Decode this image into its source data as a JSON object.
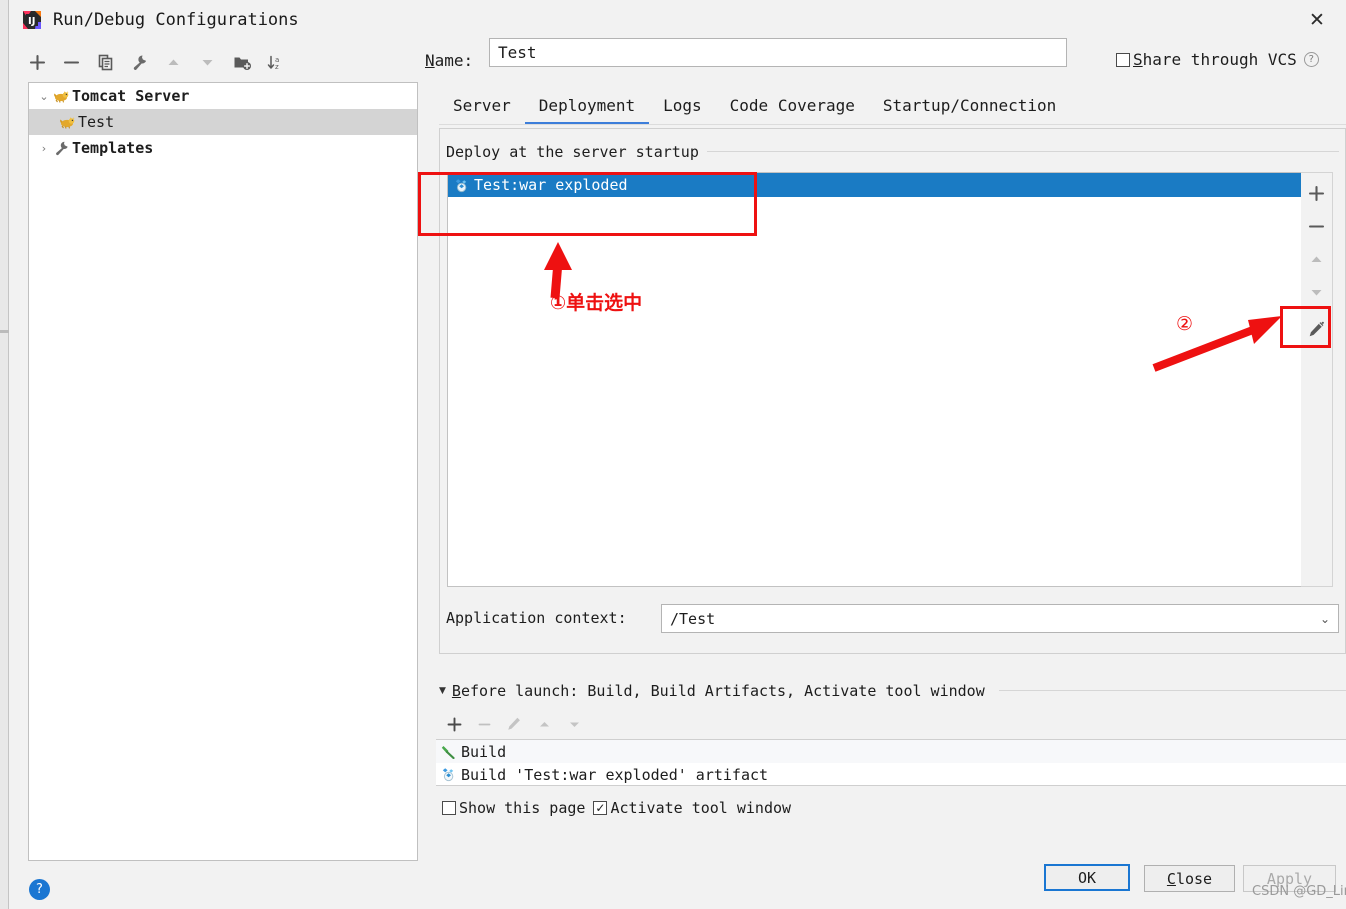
{
  "window": {
    "title": "Run/Debug Configurations",
    "app_icon": "intellij-idea-icon",
    "close_label": "✕"
  },
  "left_panel": {
    "toolbar": [
      {
        "name": "add-configuration-button",
        "icon": "plus-icon",
        "label": "+",
        "enabled": true
      },
      {
        "name": "remove-configuration-button",
        "icon": "minus-icon",
        "label": "−",
        "enabled": true
      },
      {
        "name": "copy-configuration-button",
        "icon": "copy-icon",
        "label": "copy",
        "enabled": true
      },
      {
        "name": "edit-templates-button",
        "icon": "wrench-icon",
        "label": "wrench",
        "enabled": true
      },
      {
        "name": "move-up-button",
        "icon": "arrow-up-icon",
        "label": "▲",
        "enabled": false
      },
      {
        "name": "move-down-button",
        "icon": "arrow-down-icon",
        "label": "▼",
        "enabled": false
      },
      {
        "name": "new-folder-button",
        "icon": "folder-add-icon",
        "label": "folder",
        "enabled": true
      },
      {
        "name": "sort-configurations-button",
        "icon": "sort-alpha-icon",
        "label": "sort",
        "enabled": true
      }
    ],
    "tree": [
      {
        "label": "Tomcat Server",
        "icon": "tomcat-icon",
        "twisty": "⌄",
        "indent": 0,
        "selected": false,
        "bold": true
      },
      {
        "label": "Test",
        "icon": "tomcat-icon",
        "twisty": "",
        "indent": 1,
        "selected": true,
        "bold": false
      },
      {
        "label": "Templates",
        "icon": "wrench-icon",
        "twisty": "›",
        "indent": 0,
        "selected": false,
        "bold": true
      }
    ],
    "help_button": "?"
  },
  "name_row": {
    "label_prefix": "N",
    "label_rest": "ame:",
    "value": "Test",
    "placeholder": "",
    "share_prefix": "S",
    "share_rest": "hare through VCS",
    "share_checked": false,
    "help_icon": "?"
  },
  "tabs": [
    {
      "label": "Server",
      "active": false
    },
    {
      "label": "Deployment",
      "active": true
    },
    {
      "label": "Logs",
      "active": false
    },
    {
      "label": "Code Coverage",
      "active": false
    },
    {
      "label": "Startup/Connection",
      "active": false
    }
  ],
  "deployment": {
    "group_label": "Deploy at the server startup",
    "items": [
      {
        "label": "Test:war exploded",
        "icon": "artifact-icon",
        "selected": true
      }
    ],
    "side_toolbar": [
      {
        "name": "add-artifact-button",
        "icon": "plus-icon",
        "label": "+",
        "enabled": true
      },
      {
        "name": "remove-artifact-button",
        "icon": "minus-icon",
        "label": "−",
        "enabled": true
      },
      {
        "name": "move-artifact-up-button",
        "icon": "arrow-up-icon",
        "label": "▲",
        "enabled": false
      },
      {
        "name": "move-artifact-down-button",
        "icon": "arrow-down-icon",
        "label": "▼",
        "enabled": false
      },
      {
        "name": "edit-artifact-button",
        "icon": "pencil-icon",
        "label": "edit",
        "enabled": true
      }
    ],
    "app_context_label": "Application context:",
    "app_context_value": "/Test",
    "app_context_arrow": "⌄"
  },
  "before_launch": {
    "triangle": "▼",
    "title_prefix": "B",
    "title_rest": "efore launch: Build, Build Artifacts, Activate tool window",
    "toolbar": [
      {
        "name": "add-before-launch-task-button",
        "icon": "plus-icon",
        "label": "+",
        "enabled": true
      },
      {
        "name": "remove-before-launch-task-button",
        "icon": "minus-icon",
        "label": "−",
        "enabled": false
      },
      {
        "name": "edit-before-launch-task-button",
        "icon": "pencil-icon",
        "label": "edit",
        "enabled": false
      },
      {
        "name": "before-launch-move-up-button",
        "icon": "arrow-up-icon",
        "label": "▲",
        "enabled": false
      },
      {
        "name": "before-launch-move-down-button",
        "icon": "arrow-down-icon",
        "label": "▼",
        "enabled": false
      }
    ],
    "tasks": [
      {
        "label": "Build",
        "icon": "hammer-icon"
      },
      {
        "label": "Build 'Test:war exploded' artifact",
        "icon": "artifact-icon"
      }
    ],
    "show_page_label": "Show this page",
    "show_page_checked": false,
    "activate_window_label": "Activate tool window",
    "activate_window_checked": true
  },
  "buttons": {
    "ok": "OK",
    "close_prefix": "C",
    "close_rest": "lose",
    "apply": "Apply"
  },
  "annotations": {
    "step1_text": "①单击选中",
    "step2_text": "②",
    "color": "#ee1111"
  },
  "watermark": "CSDN @GD_Limi",
  "colors": {
    "accent_blue": "#1a7bc4",
    "tab_underline": "#3d7eda",
    "selection_gray": "#d4d4d4",
    "dialog_bg": "#f2f2f2",
    "annotation_red": "#ee1111"
  }
}
